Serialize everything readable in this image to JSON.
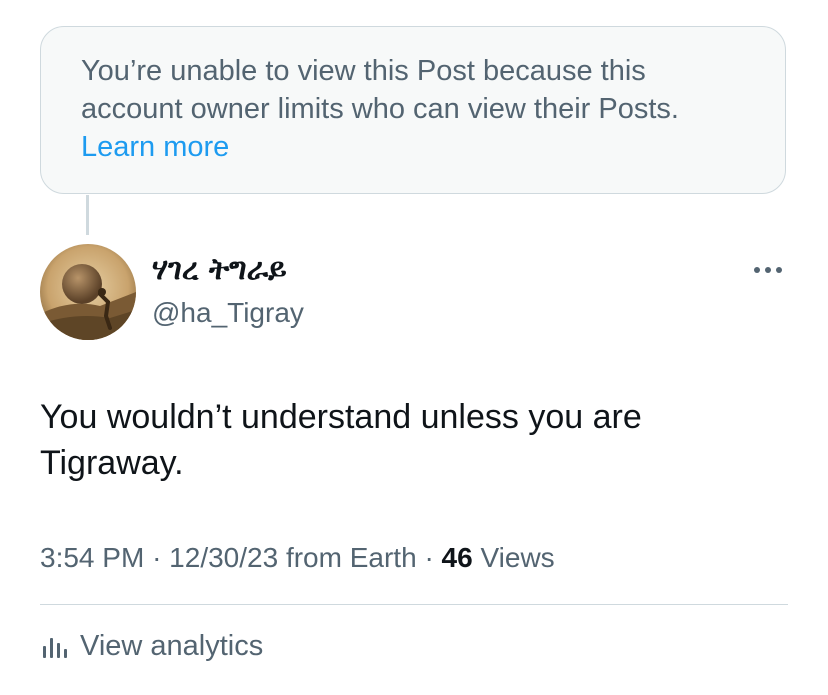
{
  "notice": {
    "text": "You’re unable to view this Post because this account owner limits who can view their Posts.",
    "link": "Learn more"
  },
  "post": {
    "display_name": "ሃገረ ትግራይ",
    "handle": "@ha_Tigray",
    "more_icon": "more-horizontal-icon",
    "text": "You wouldn’t understand unless you are Tigraway.",
    "time": "3:54 PM",
    "separator": "·",
    "date": "12/30/23",
    "source": "from Earth",
    "views_count": "46",
    "views_label": "Views"
  },
  "analytics": {
    "icon": "analytics-bars-icon",
    "label": "View analytics"
  },
  "colors": {
    "accent": "#1d9bf0",
    "secondary_text": "#536471",
    "primary_text": "#0f1419",
    "border": "#cfd9de",
    "notice_bg": "#f7f9f9"
  }
}
